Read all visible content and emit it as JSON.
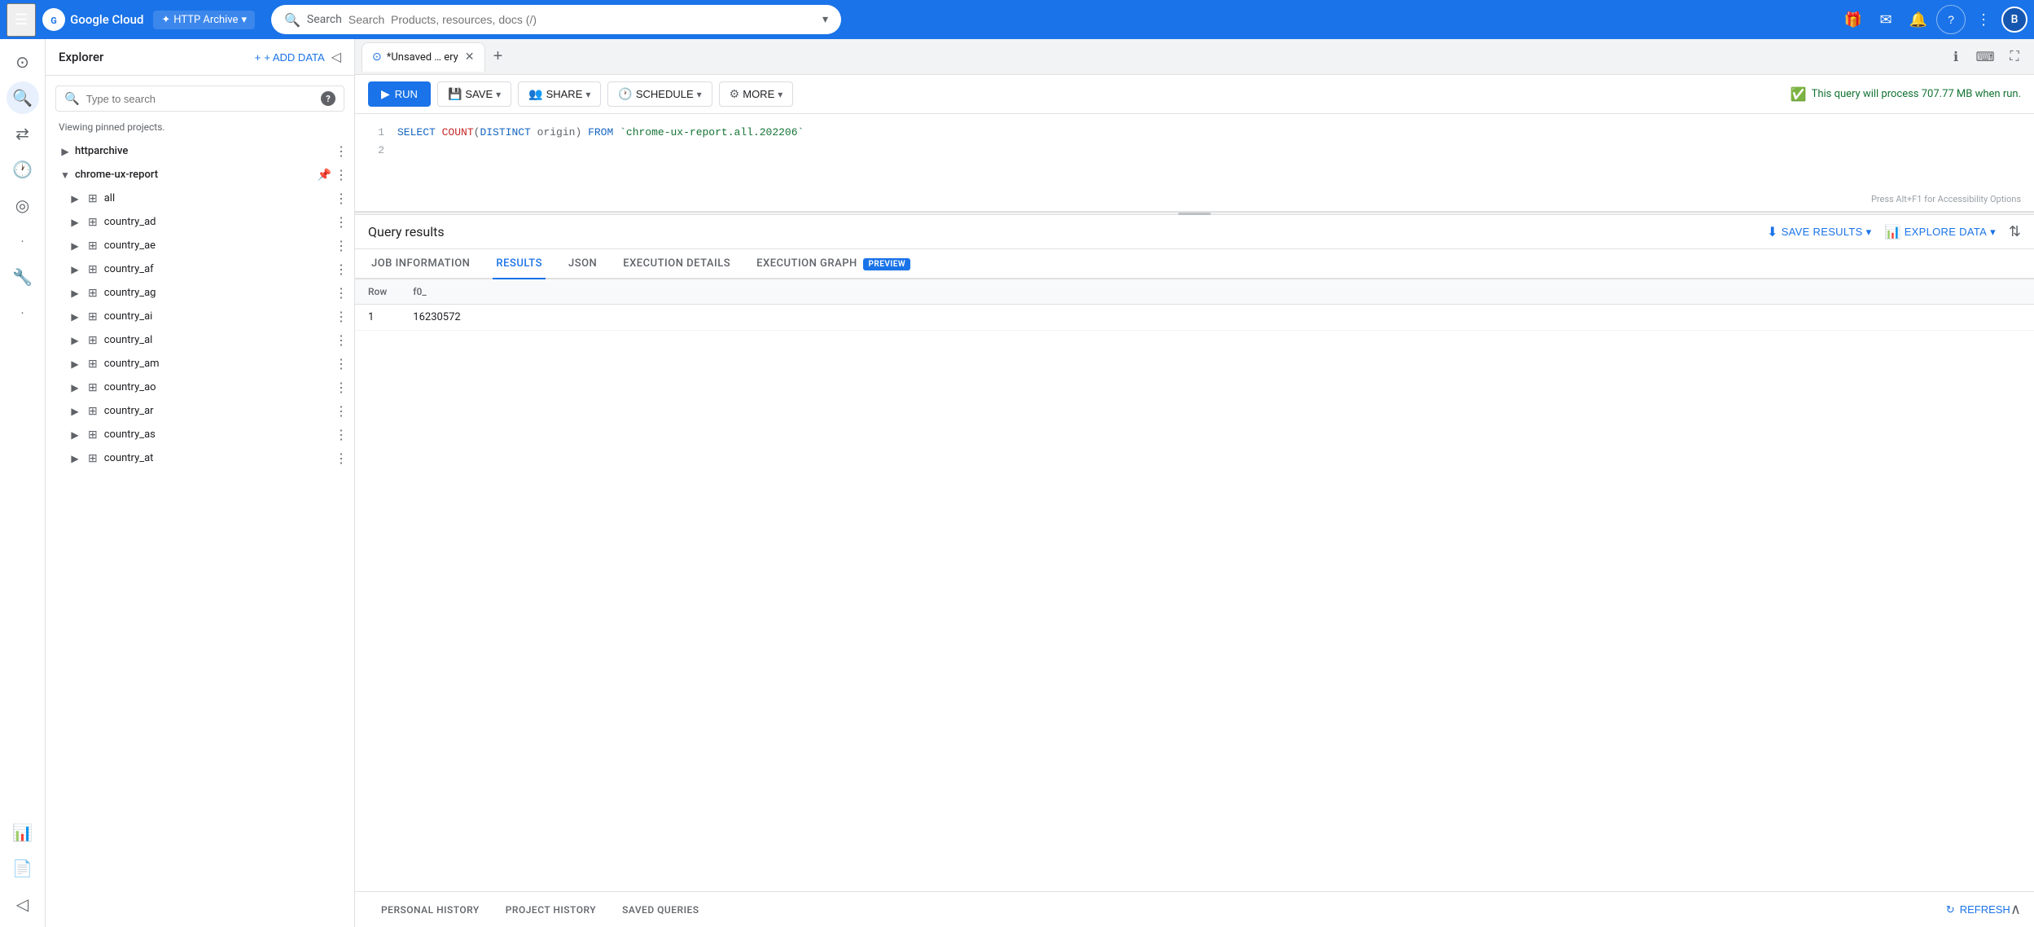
{
  "topNav": {
    "hamburger_label": "☰",
    "logo_text": "Google Cloud",
    "logo_initials": "G",
    "project_icon": "✦",
    "project_name": "HTTP Archive",
    "project_chevron": "▾",
    "search_placeholder": "Search  Products, resources, docs (/)",
    "search_icon": "🔍",
    "search_chevron": "▾",
    "icons": [
      {
        "name": "gift-icon",
        "symbol": "🎁"
      },
      {
        "name": "email-icon",
        "symbol": "✉"
      },
      {
        "name": "bell-icon",
        "symbol": "🔔"
      },
      {
        "name": "help-icon",
        "symbol": "?"
      },
      {
        "name": "more-icon",
        "symbol": "⋮"
      }
    ],
    "avatar_label": "B"
  },
  "sidebar": {
    "icons": [
      {
        "name": "dashboard-icon",
        "symbol": "⊙",
        "active": false
      },
      {
        "name": "search-icon",
        "symbol": "🔍",
        "active": true
      },
      {
        "name": "transfer-icon",
        "symbol": "⇄",
        "active": false
      },
      {
        "name": "history-icon",
        "symbol": "🕐",
        "active": false
      },
      {
        "name": "explore-icon",
        "symbol": "⦿",
        "active": false
      },
      {
        "name": "dot1-icon",
        "symbol": "•",
        "active": false
      },
      {
        "name": "wrench-icon",
        "symbol": "🔧",
        "active": false
      },
      {
        "name": "dot2-icon",
        "symbol": "•",
        "active": false
      },
      {
        "name": "chart-icon",
        "symbol": "📊",
        "active": false
      },
      {
        "name": "doc-icon",
        "symbol": "📄",
        "active": false
      },
      {
        "name": "chevron-left-icon",
        "symbol": "◁",
        "active": false
      }
    ]
  },
  "explorer": {
    "title": "Explorer",
    "add_data_label": "+ ADD DATA",
    "collapse_icon": "◁",
    "search_placeholder": "Type to search",
    "search_icon": "🔍",
    "help_icon": "?",
    "pinned_label": "Viewing pinned projects.",
    "tree": [
      {
        "level": 0,
        "name": "httparchive",
        "type": "project",
        "expanded": false,
        "has_pin": false,
        "has_more": true
      },
      {
        "level": 0,
        "name": "chrome-ux-report",
        "type": "project",
        "expanded": true,
        "has_pin": true,
        "has_more": true
      },
      {
        "level": 1,
        "name": "all",
        "type": "dataset",
        "expanded": false,
        "has_more": true
      },
      {
        "level": 1,
        "name": "country_ad",
        "type": "dataset",
        "expanded": false,
        "has_more": true
      },
      {
        "level": 1,
        "name": "country_ae",
        "type": "dataset",
        "expanded": false,
        "has_more": true
      },
      {
        "level": 1,
        "name": "country_af",
        "type": "dataset",
        "expanded": false,
        "has_more": true
      },
      {
        "level": 1,
        "name": "country_ag",
        "type": "dataset",
        "expanded": false,
        "has_more": true
      },
      {
        "level": 1,
        "name": "country_ai",
        "type": "dataset",
        "expanded": false,
        "has_more": true
      },
      {
        "level": 1,
        "name": "country_al",
        "type": "dataset",
        "expanded": false,
        "has_more": true
      },
      {
        "level": 1,
        "name": "country_am",
        "type": "dataset",
        "expanded": false,
        "has_more": true
      },
      {
        "level": 1,
        "name": "country_ao",
        "type": "dataset",
        "expanded": false,
        "has_more": true
      },
      {
        "level": 1,
        "name": "country_ar",
        "type": "dataset",
        "expanded": false,
        "has_more": true
      },
      {
        "level": 1,
        "name": "country_as",
        "type": "dataset",
        "expanded": false,
        "has_more": true
      },
      {
        "level": 1,
        "name": "country_at",
        "type": "dataset",
        "expanded": false,
        "has_more": true
      }
    ]
  },
  "tabs": {
    "items": [
      {
        "label": "*Unsaved … ery",
        "icon": "⊙",
        "closeable": true
      }
    ],
    "add_icon": "+",
    "action_icons": [
      {
        "name": "info-icon",
        "symbol": "ℹ"
      },
      {
        "name": "keyboard-icon",
        "symbol": "⌨"
      },
      {
        "name": "fullscreen-icon",
        "symbol": "⛶"
      }
    ]
  },
  "queryToolbar": {
    "run_label": "RUN",
    "run_icon": "▶",
    "save_label": "SAVE",
    "save_icon": "💾",
    "share_label": "SHARE",
    "share_icon": "👥",
    "schedule_label": "SCHEDULE",
    "schedule_icon": "🕐",
    "more_label": "MORE",
    "more_icon": "⚙",
    "query_info": "This query will process 707.77 MB when run.",
    "check_icon": "✓",
    "chevron": "▾"
  },
  "editor": {
    "lines": [
      {
        "num": "1",
        "tokens": [
          {
            "type": "kw",
            "text": "SELECT "
          },
          {
            "type": "fn",
            "text": "COUNT"
          },
          {
            "type": "code",
            "text": "("
          },
          {
            "type": "kw",
            "text": "DISTINCT "
          },
          {
            "type": "code",
            "text": "origin) "
          },
          {
            "type": "kw",
            "text": "FROM "
          },
          {
            "type": "str",
            "text": "`chrome-ux-report.all.202206`"
          }
        ]
      },
      {
        "num": "2",
        "tokens": []
      }
    ],
    "accessibility_hint": "Press Alt+F1 for Accessibility Options"
  },
  "results": {
    "title": "Query results",
    "save_results_label": "SAVE RESULTS",
    "save_results_icon": "⬇",
    "explore_data_label": "EXPLORE DATA",
    "explore_data_icon": "📊",
    "expand_icon": "⇅",
    "tabs": [
      {
        "label": "JOB INFORMATION",
        "active": false
      },
      {
        "label": "RESULTS",
        "active": true
      },
      {
        "label": "JSON",
        "active": false
      },
      {
        "label": "EXECUTION DETAILS",
        "active": false
      },
      {
        "label": "EXECUTION GRAPH",
        "active": false,
        "badge": "PREVIEW"
      }
    ],
    "table": {
      "headers": [
        "Row",
        "f0_"
      ],
      "rows": [
        [
          "1",
          "16230572"
        ]
      ]
    }
  },
  "bottomBar": {
    "tabs": [
      {
        "label": "PERSONAL HISTORY"
      },
      {
        "label": "PROJECT HISTORY"
      },
      {
        "label": "SAVED QUERIES"
      }
    ],
    "refresh_icon": "↻",
    "refresh_label": "REFRESH",
    "collapse_icon": "∧"
  }
}
